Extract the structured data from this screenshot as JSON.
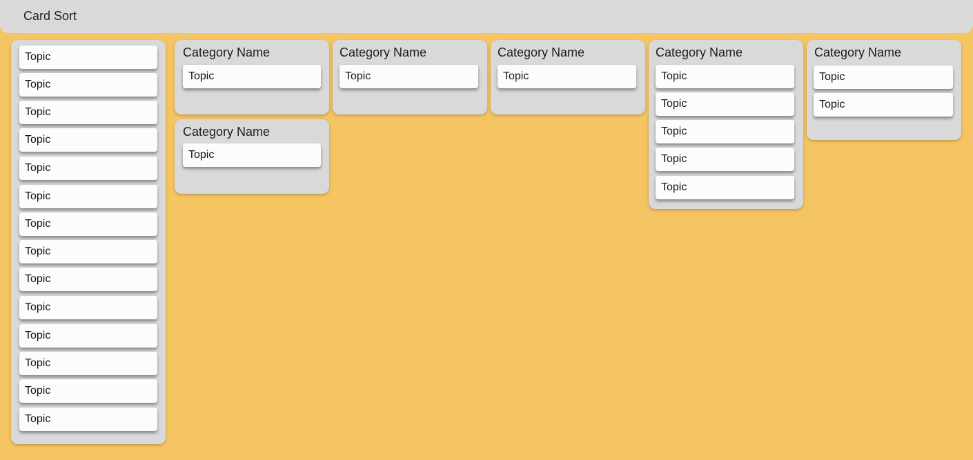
{
  "app": {
    "title": "Card Sort"
  },
  "pool": {
    "cards": [
      "Topic",
      "Topic",
      "Topic",
      "Topic",
      "Topic",
      "Topic",
      "Topic",
      "Topic",
      "Topic",
      "Topic",
      "Topic",
      "Topic",
      "Topic",
      "Topic"
    ]
  },
  "categories": [
    {
      "name": "Category Name",
      "cards": [
        "Topic"
      ]
    },
    {
      "name": "Category Name",
      "cards": [
        "Topic"
      ]
    },
    {
      "name": "Category Name",
      "cards": [
        "Topic"
      ]
    },
    {
      "name": "Category Name",
      "cards": [
        "Topic"
      ]
    },
    {
      "name": "Category Name",
      "cards": [
        "Topic",
        "Topic",
        "Topic",
        "Topic",
        "Topic"
      ]
    },
    {
      "name": "Category Name",
      "cards": [
        "Topic",
        "Topic"
      ]
    }
  ],
  "colors": {
    "background": "#f5c563",
    "panel": "#d9d9d9",
    "card": "#fbfcfc"
  }
}
